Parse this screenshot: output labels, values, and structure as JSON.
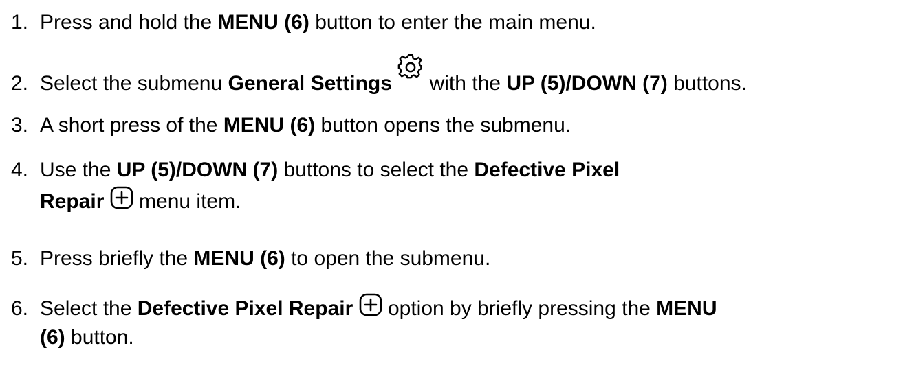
{
  "steps": [
    {
      "num": "1.",
      "parts": [
        "Press and hold the ",
        "MENU (6)",
        " button to enter the main menu."
      ]
    },
    {
      "num": "2.",
      "parts": [
        "Select the submenu ",
        "General Settings",
        " ",
        " with the ",
        "UP (5)/DOWN (7)",
        " buttons."
      ],
      "icon": "gear-icon"
    },
    {
      "num": "3.",
      "parts": [
        "A short press of the ",
        "MENU (6)",
        " button opens the submenu."
      ]
    },
    {
      "num": "4.",
      "parts": [
        "Use the ",
        "UP (5)/DOWN (7)",
        " buttons to select the ",
        "Defective Pixel",
        "Repair",
        " menu item."
      ],
      "icon": "plus-box-icon"
    },
    {
      "num": "5.",
      "parts": [
        "Press briefly the ",
        "MENU (6)",
        " to open the submenu."
      ]
    },
    {
      "num": "6.",
      "parts": [
        "Select the ",
        "Defective Pixel Repair",
        " option by briefly pressing the ",
        "MENU",
        "(6)",
        " button."
      ],
      "icon": "plus-box-icon"
    }
  ]
}
